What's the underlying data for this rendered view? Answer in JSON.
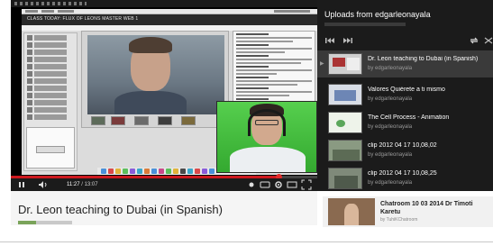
{
  "app_window": {
    "title": "CLASS TODAY: FLUX OF LEONS MASTER WEB 1"
  },
  "player": {
    "current_time": "11:27",
    "duration": "13:07",
    "progress_fraction": 0.873,
    "play_pause_icon": "pause-icon",
    "volume_icon": "speaker-icon"
  },
  "video": {
    "title": "Dr. Leon teaching to Dubai (in Spanish)"
  },
  "playlist": {
    "title": "Uploads from edgarleonayala",
    "items": [
      {
        "name": "Dr. Leon teaching to Dubai (in Spanish)",
        "by": "by edgarleonayala",
        "active": true
      },
      {
        "name": "Valores Quiérete a ti mismo",
        "by": "by edgarleonayala",
        "active": false
      },
      {
        "name": "The Cell Process - Animation",
        "by": "by edgarleonayala",
        "active": false
      },
      {
        "name": "clip 2012 04 17 10,08,02",
        "by": "by edgarleonayala",
        "active": false
      },
      {
        "name": "clip 2012 04 17 10,08,25",
        "by": "by edgarleonayala",
        "active": false
      }
    ]
  },
  "suggested": {
    "name": "Chatroom 10 03 2014 Dr Timoti Karetu",
    "by": "by TuhiKChatroom"
  },
  "colors": {
    "progress": "#cc181e",
    "player_bg": "#000000",
    "playlist_bg": "#1b1b1b",
    "green_screen": "#3fbf3c"
  }
}
